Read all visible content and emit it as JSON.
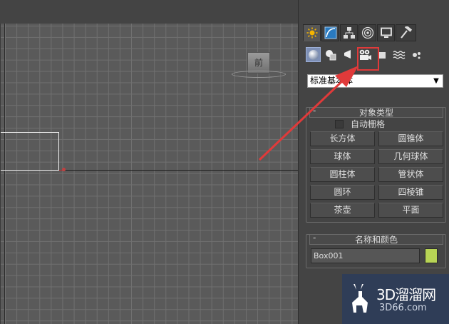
{
  "viewport": {
    "viewcube_label": "前"
  },
  "panel": {
    "tabs": [
      {
        "name": "create",
        "icon": "sun-icon"
      },
      {
        "name": "modify",
        "icon": "curve-icon"
      },
      {
        "name": "hierarchy",
        "icon": "hierarchy-icon"
      },
      {
        "name": "motion",
        "icon": "motion-icon"
      },
      {
        "name": "display",
        "icon": "monitor-icon"
      },
      {
        "name": "utilities",
        "icon": "hammer-icon"
      }
    ],
    "categories": [
      {
        "name": "geometry",
        "icon": "sphere-icon",
        "active": true
      },
      {
        "name": "shapes",
        "icon": "shapes-icon"
      },
      {
        "name": "lights",
        "icon": "light-icon"
      },
      {
        "name": "cameras",
        "icon": "camera-icon"
      },
      {
        "name": "helpers",
        "icon": "helper-icon"
      },
      {
        "name": "space-warps",
        "icon": "wave-icon"
      },
      {
        "name": "systems",
        "icon": "gear-icon"
      }
    ],
    "dropdown_value": "标准基本体",
    "object_type": {
      "title": "对象类型",
      "minus": "-",
      "autogrid_label": "自动栅格",
      "buttons": [
        "长方体",
        "圆锥体",
        "球体",
        "几何球体",
        "圆柱体",
        "管状体",
        "圆环",
        "四棱锥",
        "茶壶",
        "平面"
      ]
    },
    "name_color": {
      "title": "名称和颜色",
      "minus": "-",
      "name_value": "Box001",
      "swatch_color": "#b8d455"
    }
  },
  "watermark": {
    "line1": "3D溜溜网",
    "line2": "3D66.com"
  }
}
